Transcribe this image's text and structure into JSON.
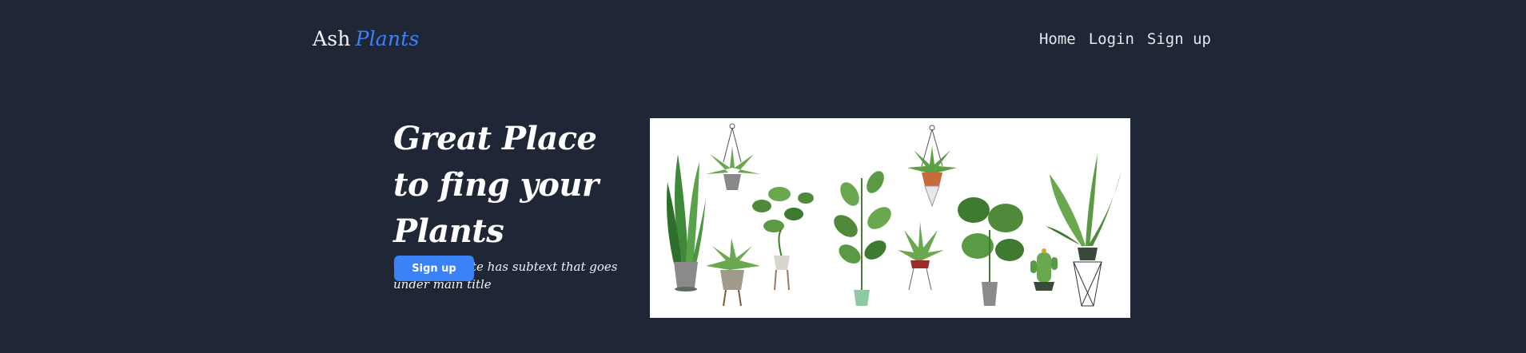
{
  "header": {
    "brand_first": "Ash",
    "brand_second": "Plants",
    "nav": [
      "Home",
      "Login",
      "Sign up"
    ]
  },
  "hero": {
    "title": "Great Place to fing your Plants",
    "subtitle": "This is website has subtext that goes under main title",
    "cta_label": "Sign up"
  },
  "image": {
    "icon": "house-plants-illustration",
    "accent_color": "#3b82f6",
    "background_color": "#1f2737"
  }
}
